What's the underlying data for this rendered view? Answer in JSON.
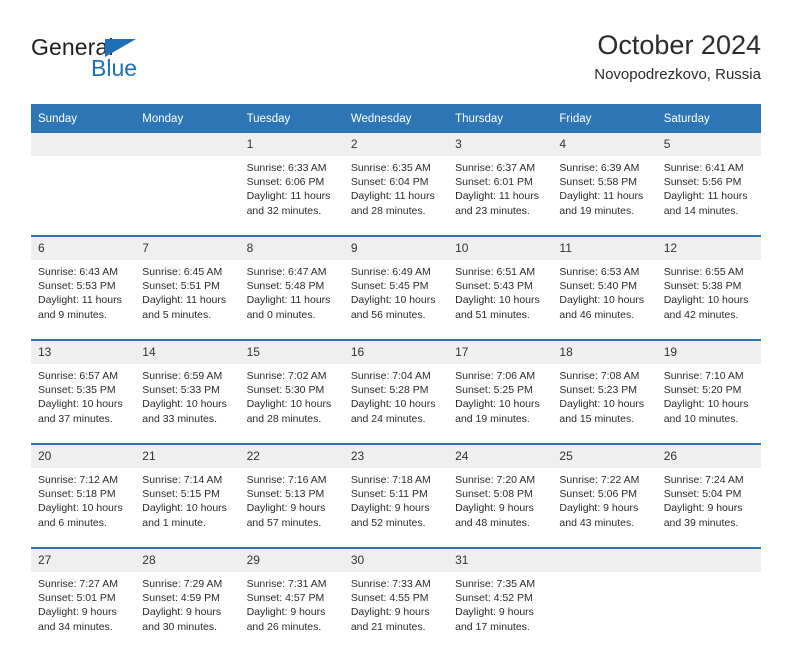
{
  "brand": {
    "name_top": "General",
    "name_bottom": "Blue",
    "accent_color": "#1d70b7"
  },
  "header": {
    "title": "October 2024",
    "subtitle": "Novopodrezkovo, Russia"
  },
  "calendar": {
    "header_bg": "#2e75b6",
    "daynum_bg": "#efefef",
    "weekday_headers": [
      "Sunday",
      "Monday",
      "Tuesday",
      "Wednesday",
      "Thursday",
      "Friday",
      "Saturday"
    ],
    "weeks": [
      [
        {
          "day": "",
          "sunrise": "",
          "sunset": "",
          "daylight": "",
          "daylight2": ""
        },
        {
          "day": "",
          "sunrise": "",
          "sunset": "",
          "daylight": "",
          "daylight2": ""
        },
        {
          "day": "1",
          "sunrise": "Sunrise: 6:33 AM",
          "sunset": "Sunset: 6:06 PM",
          "daylight": "Daylight: 11 hours",
          "daylight2": "and 32 minutes."
        },
        {
          "day": "2",
          "sunrise": "Sunrise: 6:35 AM",
          "sunset": "Sunset: 6:04 PM",
          "daylight": "Daylight: 11 hours",
          "daylight2": "and 28 minutes."
        },
        {
          "day": "3",
          "sunrise": "Sunrise: 6:37 AM",
          "sunset": "Sunset: 6:01 PM",
          "daylight": "Daylight: 11 hours",
          "daylight2": "and 23 minutes."
        },
        {
          "day": "4",
          "sunrise": "Sunrise: 6:39 AM",
          "sunset": "Sunset: 5:58 PM",
          "daylight": "Daylight: 11 hours",
          "daylight2": "and 19 minutes."
        },
        {
          "day": "5",
          "sunrise": "Sunrise: 6:41 AM",
          "sunset": "Sunset: 5:56 PM",
          "daylight": "Daylight: 11 hours",
          "daylight2": "and 14 minutes."
        }
      ],
      [
        {
          "day": "6",
          "sunrise": "Sunrise: 6:43 AM",
          "sunset": "Sunset: 5:53 PM",
          "daylight": "Daylight: 11 hours",
          "daylight2": "and 9 minutes."
        },
        {
          "day": "7",
          "sunrise": "Sunrise: 6:45 AM",
          "sunset": "Sunset: 5:51 PM",
          "daylight": "Daylight: 11 hours",
          "daylight2": "and 5 minutes."
        },
        {
          "day": "8",
          "sunrise": "Sunrise: 6:47 AM",
          "sunset": "Sunset: 5:48 PM",
          "daylight": "Daylight: 11 hours",
          "daylight2": "and 0 minutes."
        },
        {
          "day": "9",
          "sunrise": "Sunrise: 6:49 AM",
          "sunset": "Sunset: 5:45 PM",
          "daylight": "Daylight: 10 hours",
          "daylight2": "and 56 minutes."
        },
        {
          "day": "10",
          "sunrise": "Sunrise: 6:51 AM",
          "sunset": "Sunset: 5:43 PM",
          "daylight": "Daylight: 10 hours",
          "daylight2": "and 51 minutes."
        },
        {
          "day": "11",
          "sunrise": "Sunrise: 6:53 AM",
          "sunset": "Sunset: 5:40 PM",
          "daylight": "Daylight: 10 hours",
          "daylight2": "and 46 minutes."
        },
        {
          "day": "12",
          "sunrise": "Sunrise: 6:55 AM",
          "sunset": "Sunset: 5:38 PM",
          "daylight": "Daylight: 10 hours",
          "daylight2": "and 42 minutes."
        }
      ],
      [
        {
          "day": "13",
          "sunrise": "Sunrise: 6:57 AM",
          "sunset": "Sunset: 5:35 PM",
          "daylight": "Daylight: 10 hours",
          "daylight2": "and 37 minutes."
        },
        {
          "day": "14",
          "sunrise": "Sunrise: 6:59 AM",
          "sunset": "Sunset: 5:33 PM",
          "daylight": "Daylight: 10 hours",
          "daylight2": "and 33 minutes."
        },
        {
          "day": "15",
          "sunrise": "Sunrise: 7:02 AM",
          "sunset": "Sunset: 5:30 PM",
          "daylight": "Daylight: 10 hours",
          "daylight2": "and 28 minutes."
        },
        {
          "day": "16",
          "sunrise": "Sunrise: 7:04 AM",
          "sunset": "Sunset: 5:28 PM",
          "daylight": "Daylight: 10 hours",
          "daylight2": "and 24 minutes."
        },
        {
          "day": "17",
          "sunrise": "Sunrise: 7:06 AM",
          "sunset": "Sunset: 5:25 PM",
          "daylight": "Daylight: 10 hours",
          "daylight2": "and 19 minutes."
        },
        {
          "day": "18",
          "sunrise": "Sunrise: 7:08 AM",
          "sunset": "Sunset: 5:23 PM",
          "daylight": "Daylight: 10 hours",
          "daylight2": "and 15 minutes."
        },
        {
          "day": "19",
          "sunrise": "Sunrise: 7:10 AM",
          "sunset": "Sunset: 5:20 PM",
          "daylight": "Daylight: 10 hours",
          "daylight2": "and 10 minutes."
        }
      ],
      [
        {
          "day": "20",
          "sunrise": "Sunrise: 7:12 AM",
          "sunset": "Sunset: 5:18 PM",
          "daylight": "Daylight: 10 hours",
          "daylight2": "and 6 minutes."
        },
        {
          "day": "21",
          "sunrise": "Sunrise: 7:14 AM",
          "sunset": "Sunset: 5:15 PM",
          "daylight": "Daylight: 10 hours",
          "daylight2": "and 1 minute."
        },
        {
          "day": "22",
          "sunrise": "Sunrise: 7:16 AM",
          "sunset": "Sunset: 5:13 PM",
          "daylight": "Daylight: 9 hours",
          "daylight2": "and 57 minutes."
        },
        {
          "day": "23",
          "sunrise": "Sunrise: 7:18 AM",
          "sunset": "Sunset: 5:11 PM",
          "daylight": "Daylight: 9 hours",
          "daylight2": "and 52 minutes."
        },
        {
          "day": "24",
          "sunrise": "Sunrise: 7:20 AM",
          "sunset": "Sunset: 5:08 PM",
          "daylight": "Daylight: 9 hours",
          "daylight2": "and 48 minutes."
        },
        {
          "day": "25",
          "sunrise": "Sunrise: 7:22 AM",
          "sunset": "Sunset: 5:06 PM",
          "daylight": "Daylight: 9 hours",
          "daylight2": "and 43 minutes."
        },
        {
          "day": "26",
          "sunrise": "Sunrise: 7:24 AM",
          "sunset": "Sunset: 5:04 PM",
          "daylight": "Daylight: 9 hours",
          "daylight2": "and 39 minutes."
        }
      ],
      [
        {
          "day": "27",
          "sunrise": "Sunrise: 7:27 AM",
          "sunset": "Sunset: 5:01 PM",
          "daylight": "Daylight: 9 hours",
          "daylight2": "and 34 minutes."
        },
        {
          "day": "28",
          "sunrise": "Sunrise: 7:29 AM",
          "sunset": "Sunset: 4:59 PM",
          "daylight": "Daylight: 9 hours",
          "daylight2": "and 30 minutes."
        },
        {
          "day": "29",
          "sunrise": "Sunrise: 7:31 AM",
          "sunset": "Sunset: 4:57 PM",
          "daylight": "Daylight: 9 hours",
          "daylight2": "and 26 minutes."
        },
        {
          "day": "30",
          "sunrise": "Sunrise: 7:33 AM",
          "sunset": "Sunset: 4:55 PM",
          "daylight": "Daylight: 9 hours",
          "daylight2": "and 21 minutes."
        },
        {
          "day": "31",
          "sunrise": "Sunrise: 7:35 AM",
          "sunset": "Sunset: 4:52 PM",
          "daylight": "Daylight: 9 hours",
          "daylight2": "and 17 minutes."
        },
        {
          "day": "",
          "sunrise": "",
          "sunset": "",
          "daylight": "",
          "daylight2": ""
        },
        {
          "day": "",
          "sunrise": "",
          "sunset": "",
          "daylight": "",
          "daylight2": ""
        }
      ]
    ]
  }
}
